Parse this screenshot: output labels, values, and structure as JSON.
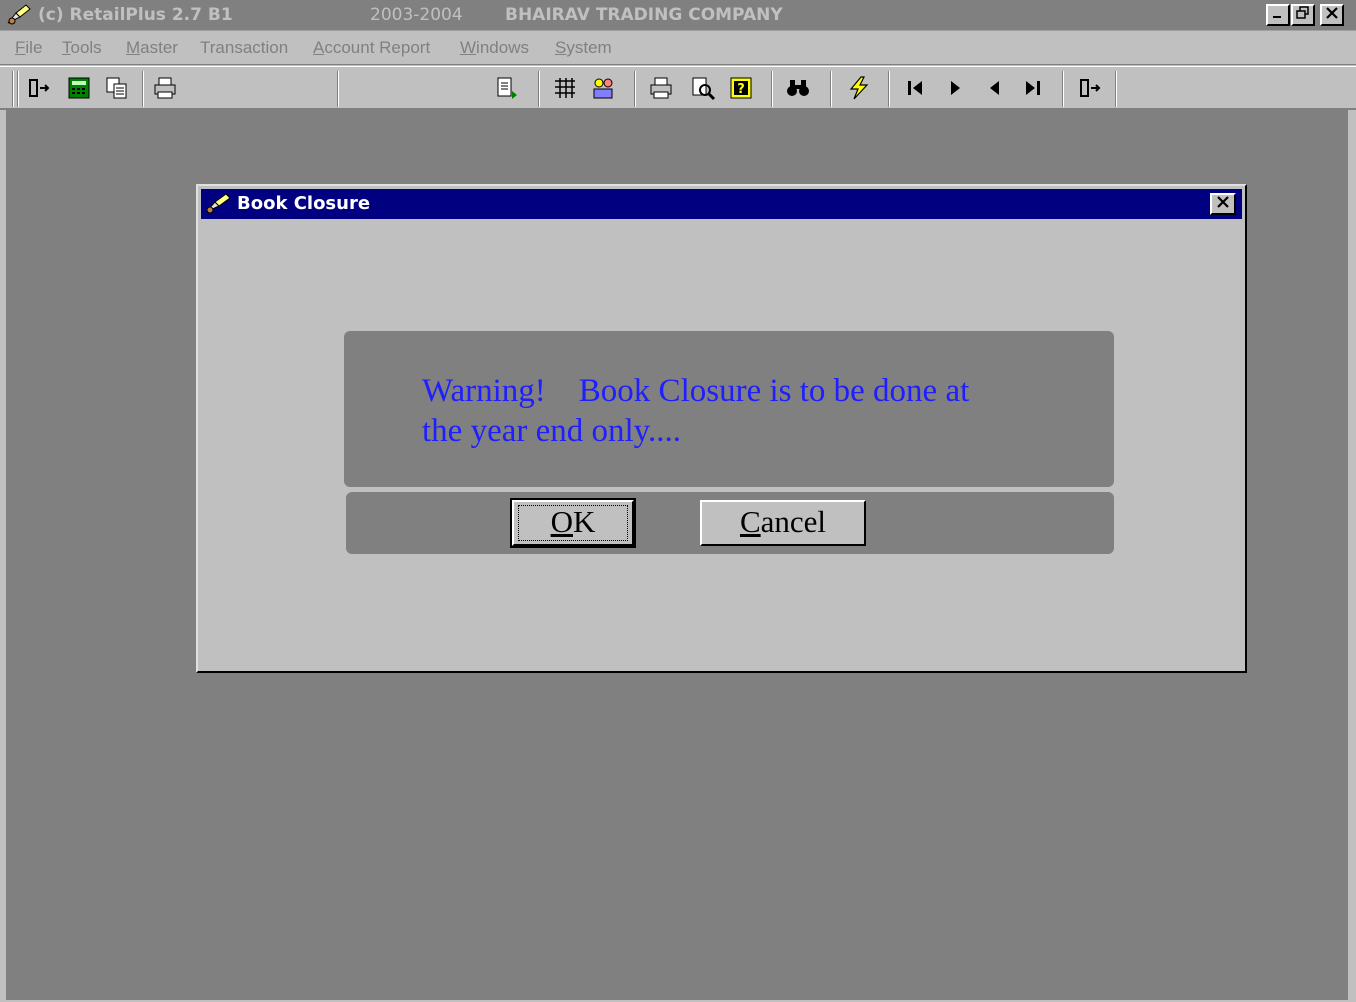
{
  "window": {
    "app_title": "(c) RetailPlus 2.7 B1",
    "fiscal_year": "2003-2004",
    "company": "BHAIRAV TRADING COMPANY",
    "controls": [
      "_",
      "̸",
      "×"
    ]
  },
  "menu": {
    "items": [
      {
        "first": "F",
        "rest": "ile"
      },
      {
        "first": "T",
        "rest": "ools"
      },
      {
        "first": "M",
        "rest": "aster"
      },
      {
        "first": "T",
        "rest": "ransaction",
        "prefix": ""
      },
      {
        "first": "A",
        "rest": "ccount Report"
      },
      {
        "first": "W",
        "rest": "indows"
      },
      {
        "first": "S",
        "rest": "ystem"
      }
    ]
  },
  "toolbar": {
    "icons": [
      "exit-icon",
      "calculator-icon",
      "copy-icon",
      "print-icon",
      "document-icon",
      "grid-icon",
      "group-icon",
      "printer-icon",
      "preview-icon",
      "help-icon",
      "find-icon",
      "flash-icon",
      "first-record-icon",
      "next-record-icon",
      "prev-record-icon",
      "last-record-icon",
      "exit-icon"
    ]
  },
  "dialog": {
    "title": "Book Closure",
    "message": "Warning!    Book Closure is to be done at\nthe year end only....",
    "ok_first": "O",
    "ok_rest": "K",
    "cancel_first": "C",
    "cancel_rest": "ancel",
    "colors": {
      "title_bar": "#000080",
      "message_text": "#1e1eff",
      "panel": "#808080"
    }
  }
}
